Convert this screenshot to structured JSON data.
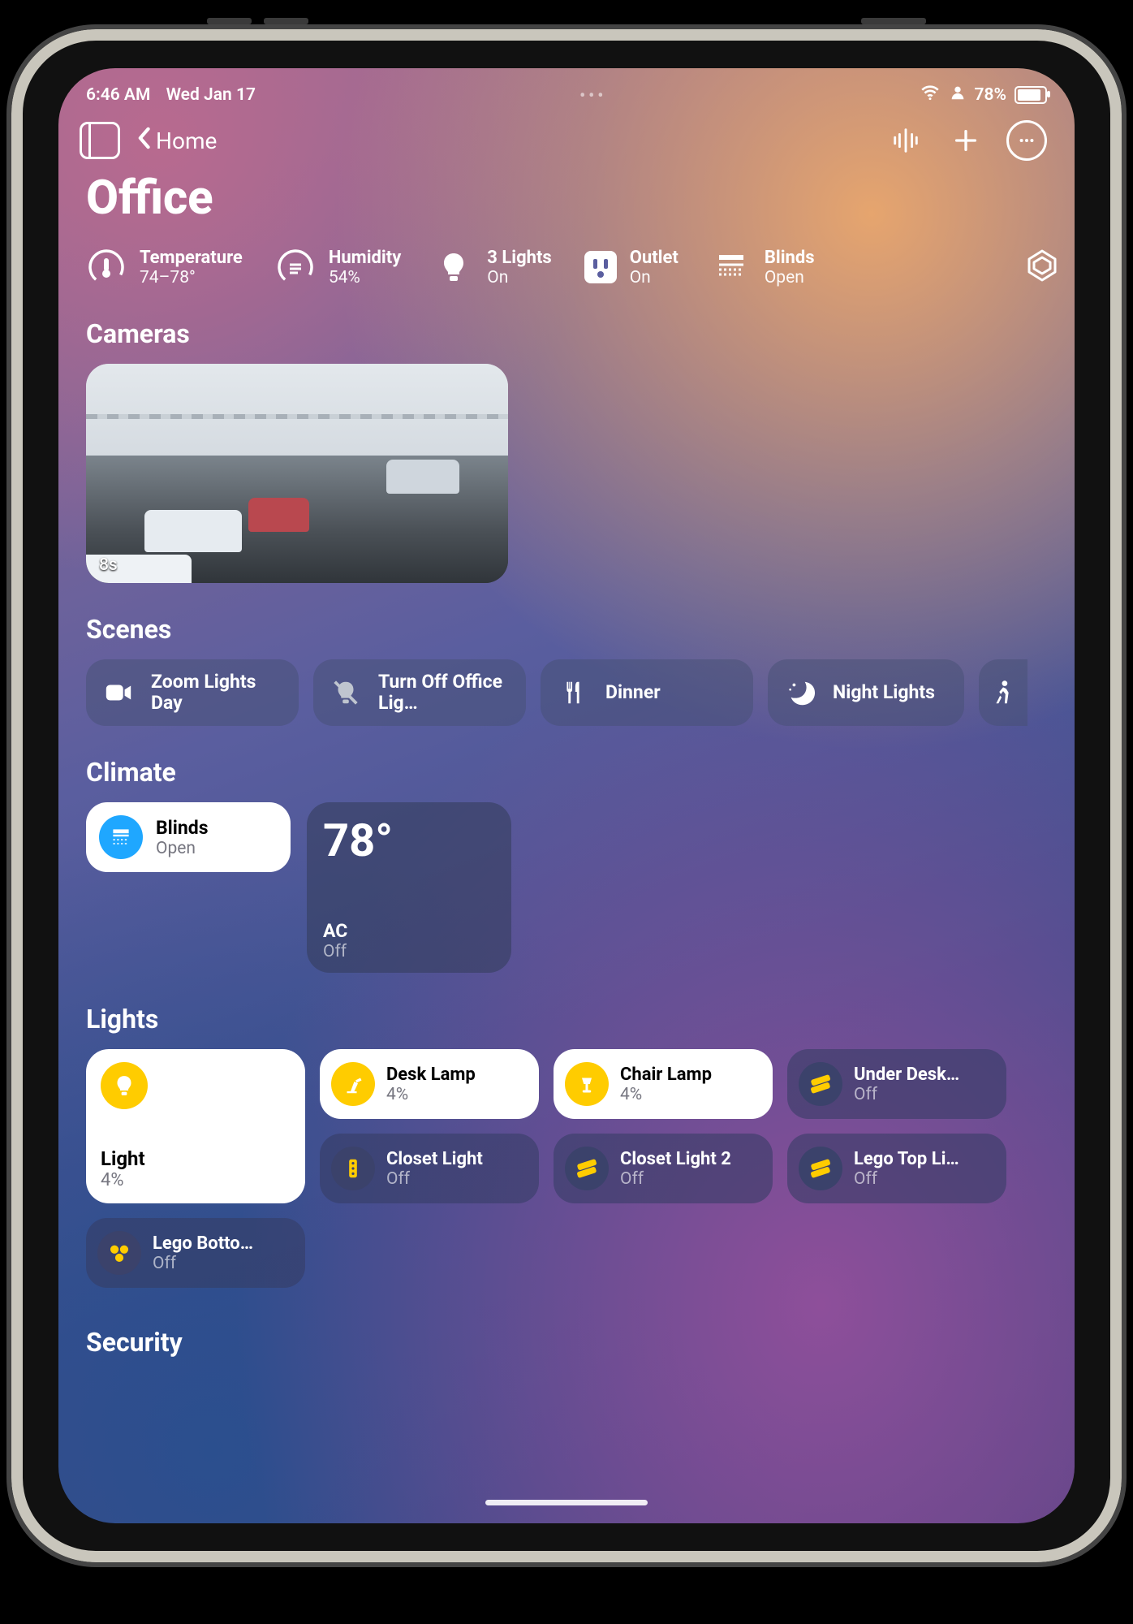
{
  "statusbar": {
    "time": "6:46 AM",
    "date": "Wed Jan 17",
    "battery_pct": "78%"
  },
  "nav": {
    "back_label": "Home"
  },
  "page": {
    "title": "Office"
  },
  "summary": {
    "temperature": {
      "label": "Temperature",
      "value": "74–78°"
    },
    "humidity": {
      "label": "Humidity",
      "value": "54%"
    },
    "lights": {
      "label": "3 Lights",
      "value": "On"
    },
    "outlet": {
      "label": "Outlet",
      "value": "On"
    },
    "blinds": {
      "label": "Blinds",
      "value": "Open"
    }
  },
  "sections": {
    "cameras": "Cameras",
    "scenes": "Scenes",
    "climate": "Climate",
    "lights": "Lights",
    "security": "Security"
  },
  "camera": {
    "timestamp": "8s"
  },
  "scenes": {
    "zoom": "Zoom Lights Day",
    "turnoff": "Turn Off Office Lig…",
    "dinner": "Dinner",
    "night": "Night Lights"
  },
  "climate": {
    "blinds": {
      "title": "Blinds",
      "state": "Open"
    },
    "ac": {
      "temp": "78°",
      "title": "AC",
      "state": "Off"
    }
  },
  "lights": {
    "main": {
      "title": "Light",
      "state": "4%"
    },
    "desk": {
      "title": "Desk Lamp",
      "state": "4%"
    },
    "chair": {
      "title": "Chair Lamp",
      "state": "4%"
    },
    "under": {
      "title": "Under Desk…",
      "state": "Off"
    },
    "closet1": {
      "title": "Closet Light",
      "state": "Off"
    },
    "closet2": {
      "title": "Closet Light 2",
      "state": "Off"
    },
    "legotop": {
      "title": "Lego Top Li…",
      "state": "Off"
    },
    "legobottom": {
      "title": "Lego Botto…",
      "state": "Off"
    }
  }
}
